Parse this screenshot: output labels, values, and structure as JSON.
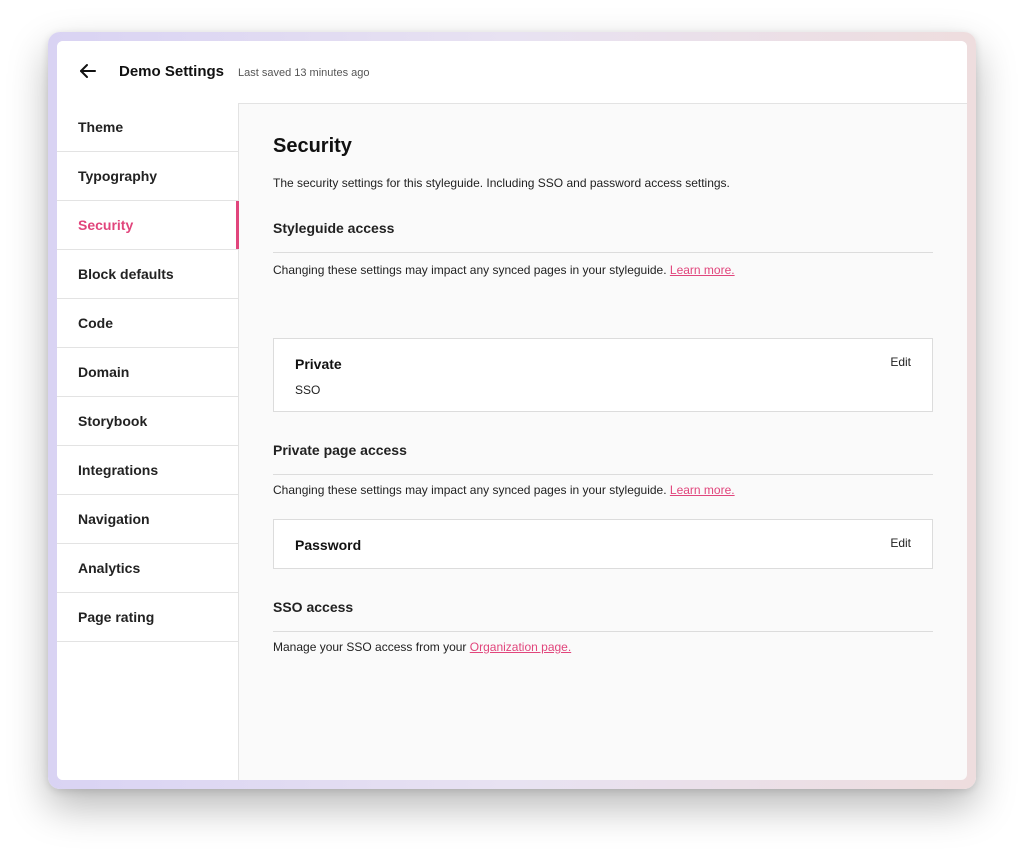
{
  "header": {
    "title": "Demo Settings",
    "last_saved": "Last saved 13 minutes ago",
    "back_icon": "arrow-left-icon"
  },
  "sidebar": {
    "active": "Security",
    "items": [
      {
        "label": "Theme"
      },
      {
        "label": "Typography"
      },
      {
        "label": "Security"
      },
      {
        "label": "Block defaults"
      },
      {
        "label": "Code"
      },
      {
        "label": "Domain"
      },
      {
        "label": "Storybook"
      },
      {
        "label": "Integrations"
      },
      {
        "label": "Navigation"
      },
      {
        "label": "Analytics"
      },
      {
        "label": "Page rating"
      }
    ]
  },
  "main": {
    "title": "Security",
    "description": "The security settings for this styleguide. Including SSO and password access settings.",
    "styleguide_access": {
      "title": "Styleguide access",
      "note": "Changing these settings may impact any synced pages in your styleguide.",
      "link": "Learn more.",
      "card": {
        "title": "Private",
        "subtitle": "SSO",
        "edit": "Edit"
      }
    },
    "private_page_access": {
      "title": "Private page access",
      "note": "Changing these settings may impact any synced pages in your styleguide.",
      "link": "Learn more.",
      "card": {
        "title": "Password",
        "edit": "Edit"
      }
    },
    "sso_access": {
      "title": "SSO access",
      "note": "Manage your SSO access from your",
      "link": "Organization page."
    }
  },
  "colors": {
    "accent": "#e1457c",
    "window_background": "#fafafa",
    "border": "#e3e3e3"
  }
}
